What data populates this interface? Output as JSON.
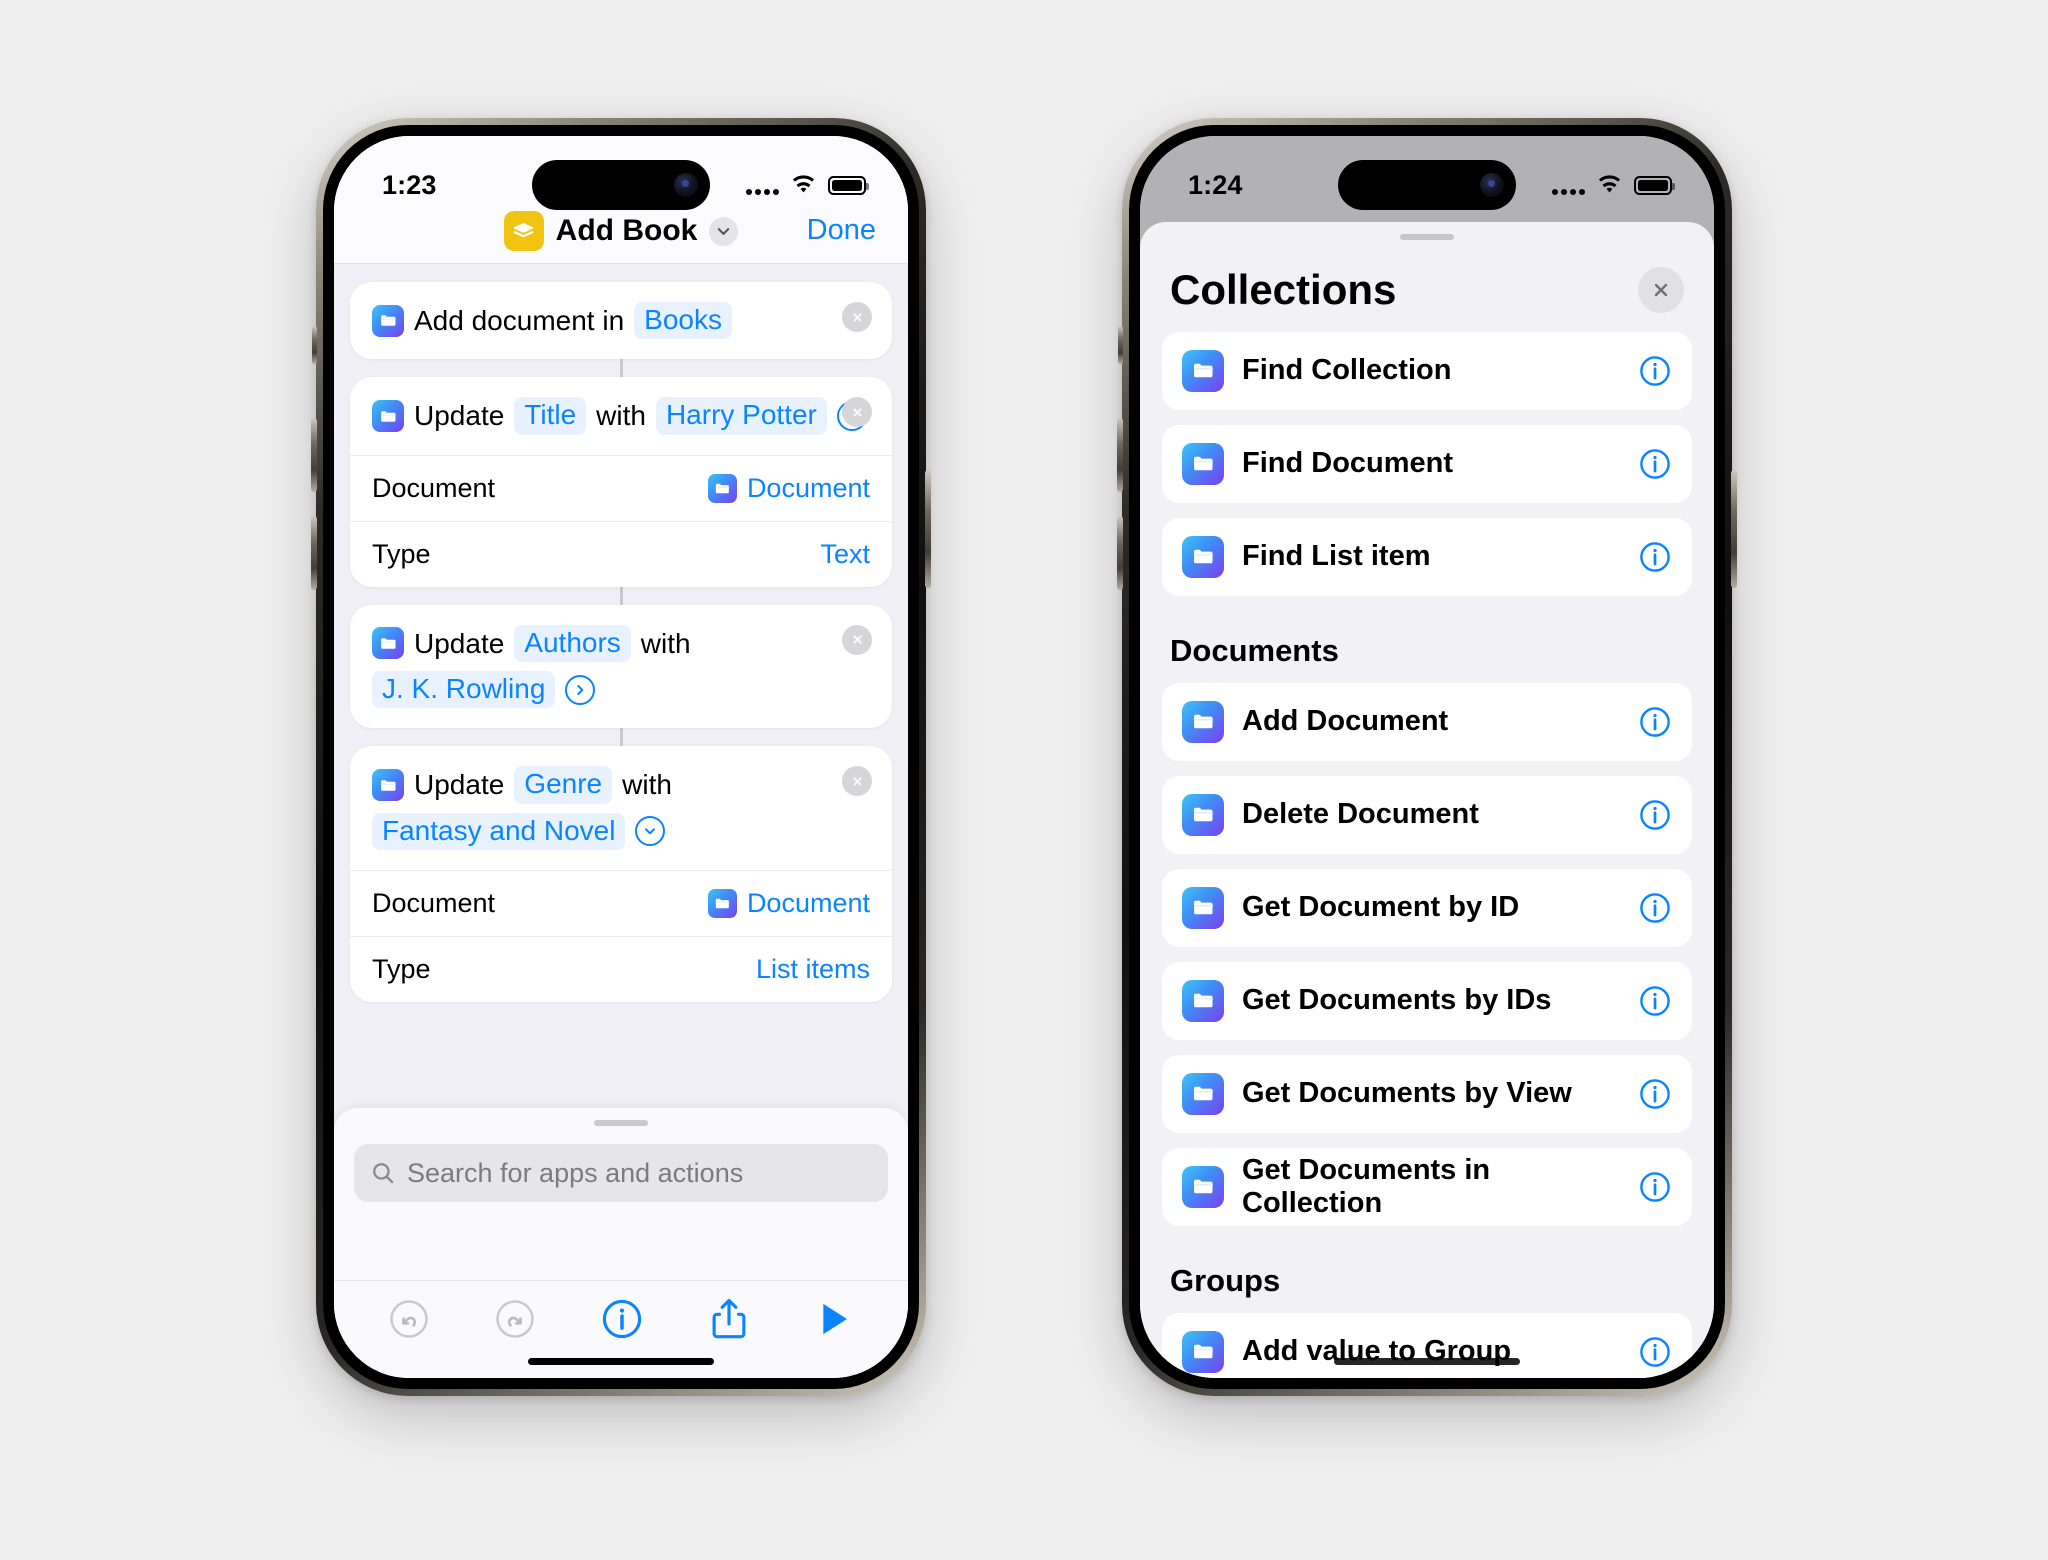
{
  "left_phone": {
    "status_bar": {
      "time": "1:23",
      "wifi_icon": "wifi-icon",
      "battery_icon": "battery-icon",
      "signal_icon": "signal-dots-icon"
    },
    "nav": {
      "shortcut_icon": "shortcut-layers-icon",
      "title": "Add Book",
      "disclosure_icon": "chevron-down-icon",
      "done_label": "Done"
    },
    "actions": [
      {
        "icon": "document-app-icon",
        "remove_icon": "close-circle-icon",
        "tokens": [
          {
            "text": "Add document in",
            "style": "plain"
          },
          {
            "text": "Books",
            "style": "token"
          }
        ],
        "params": []
      },
      {
        "icon": "document-app-icon",
        "remove_icon": "close-circle-icon",
        "tokens": [
          {
            "text": "Update",
            "style": "plain"
          },
          {
            "text": "Title",
            "style": "token"
          },
          {
            "text": "with",
            "style": "plain"
          },
          {
            "text": "Harry Potter",
            "style": "token"
          }
        ],
        "expand_icon": "chevron-down-circle-icon",
        "params": [
          {
            "label": "Document",
            "value": "Document",
            "value_icon": "document-app-icon"
          },
          {
            "label": "Type",
            "value": "Text",
            "value_icon": null
          }
        ]
      },
      {
        "icon": "document-app-icon",
        "remove_icon": "close-circle-icon",
        "tokens": [
          {
            "text": "Update",
            "style": "plain"
          },
          {
            "text": "Authors",
            "style": "token"
          },
          {
            "text": "with",
            "style": "plain"
          },
          {
            "text": "J. K. Rowling",
            "style": "token"
          }
        ],
        "expand_icon": "chevron-right-circle-icon",
        "params": []
      },
      {
        "icon": "document-app-icon",
        "remove_icon": "close-circle-icon",
        "tokens": [
          {
            "text": "Update",
            "style": "plain"
          },
          {
            "text": "Genre",
            "style": "token"
          },
          {
            "text": "with",
            "style": "plain"
          },
          {
            "text": "Fantasy and Novel",
            "style": "token"
          }
        ],
        "expand_icon": "chevron-down-circle-icon",
        "params": [
          {
            "label": "Document",
            "value": "Document",
            "value_icon": "document-app-icon"
          },
          {
            "label": "Type",
            "value": "List items",
            "value_icon": null
          }
        ]
      }
    ],
    "sheet": {
      "search_placeholder": "Search for apps and actions",
      "search_icon": "search-icon",
      "toolbar": [
        {
          "name": "undo-button",
          "icon": "undo-icon",
          "enabled": false
        },
        {
          "name": "redo-button",
          "icon": "redo-icon",
          "enabled": false
        },
        {
          "name": "info-button",
          "icon": "info-circle-icon",
          "enabled": true
        },
        {
          "name": "share-button",
          "icon": "share-icon",
          "enabled": true
        },
        {
          "name": "run-button",
          "icon": "play-icon",
          "enabled": true
        }
      ]
    }
  },
  "right_phone": {
    "status_bar": {
      "time": "1:24",
      "wifi_icon": "wifi-icon",
      "battery_icon": "battery-icon",
      "signal_icon": "signal-dots-icon"
    },
    "modal": {
      "title": "Collections",
      "close_icon": "close-icon",
      "sections": [
        {
          "header": null,
          "items": [
            {
              "label": "Find Collection",
              "icon": "document-app-icon",
              "info_icon": "info-circle-icon"
            },
            {
              "label": "Find Document",
              "icon": "document-app-icon",
              "info_icon": "info-circle-icon"
            },
            {
              "label": "Find List item",
              "icon": "document-app-icon",
              "info_icon": "info-circle-icon"
            }
          ]
        },
        {
          "header": "Documents",
          "items": [
            {
              "label": "Add Document",
              "icon": "document-app-icon",
              "info_icon": "info-circle-icon"
            },
            {
              "label": "Delete Document",
              "icon": "document-app-icon",
              "info_icon": "info-circle-icon"
            },
            {
              "label": "Get Document by ID",
              "icon": "document-app-icon",
              "info_icon": "info-circle-icon"
            },
            {
              "label": "Get Documents by IDs",
              "icon": "document-app-icon",
              "info_icon": "info-circle-icon"
            },
            {
              "label": "Get Documents by View",
              "icon": "document-app-icon",
              "info_icon": "info-circle-icon"
            },
            {
              "label": "Get Documents in Collection",
              "icon": "document-app-icon",
              "info_icon": "info-circle-icon"
            }
          ]
        },
        {
          "header": "Groups",
          "items": [
            {
              "label": "Add value to Group",
              "icon": "document-app-icon",
              "info_icon": "info-circle-icon"
            }
          ]
        }
      ]
    }
  },
  "colors": {
    "accent_blue": "#0a84ff",
    "token_bg": "#e8f2fe",
    "canvas_bg": "#f0eff5",
    "shortcut_yellow": "#f0c410",
    "modal_bg": "#f2f1f6"
  }
}
